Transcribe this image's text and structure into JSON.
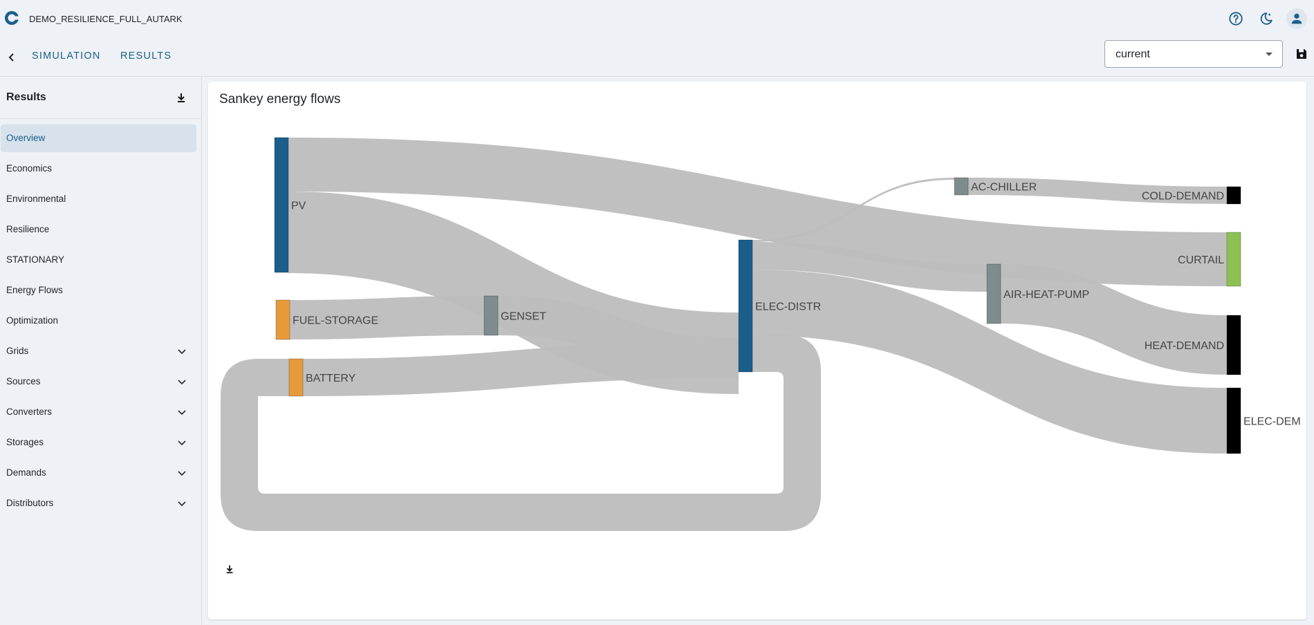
{
  "app": {
    "title": "DEMO_RESILIENCE_FULL_AUTARK"
  },
  "icons": {
    "logo": "app-logo-icon",
    "help": "help-circle-icon",
    "theme": "moon-star-icon",
    "profile": "account-icon",
    "back": "chevron-left-icon",
    "save": "floppy-disk-icon",
    "download": "download-icon",
    "expand": "chevron-down-icon"
  },
  "nav": {
    "tabs": [
      {
        "label": "SIMULATION"
      },
      {
        "label": "RESULTS"
      }
    ]
  },
  "scenario_select": {
    "value": "current"
  },
  "sidebar": {
    "title": "Results",
    "items": [
      {
        "label": "Overview",
        "active": true,
        "expandable": false
      },
      {
        "label": "Economics",
        "expandable": false
      },
      {
        "label": "Environmental",
        "expandable": false
      },
      {
        "label": "Resilience",
        "expandable": false
      },
      {
        "label": "STATIONARY",
        "expandable": false
      },
      {
        "label": "Energy Flows",
        "expandable": false
      },
      {
        "label": "Optimization",
        "expandable": false
      },
      {
        "label": "Grids",
        "expandable": true
      },
      {
        "label": "Sources",
        "expandable": true
      },
      {
        "label": "Converters",
        "expandable": true
      },
      {
        "label": "Storages",
        "expandable": true
      },
      {
        "label": "Demands",
        "expandable": true
      },
      {
        "label": "Distributors",
        "expandable": true
      }
    ]
  },
  "main": {
    "card_title": "Sankey energy flows"
  },
  "colors": {
    "accent": "#1a5f8a",
    "pv": "#1b5e8a",
    "storage": "#e79a3c",
    "converter": "#7f8c8d",
    "curtail": "#8cc152",
    "demand": "#000000",
    "link": "#bdbdbd"
  },
  "chart_data": {
    "type": "sankey",
    "nodes": [
      {
        "id": "PV",
        "label": "PV",
        "color": "#1b5e8a"
      },
      {
        "id": "FUEL-STORAGE",
        "label": "FUEL-STORAGE",
        "color": "#e79a3c"
      },
      {
        "id": "BATTERY",
        "label": "BATTERY",
        "color": "#e79a3c"
      },
      {
        "id": "GENSET",
        "label": "GENSET",
        "color": "#7f8c8d"
      },
      {
        "id": "ELEC-DISTR",
        "label": "ELEC-DISTR",
        "color": "#1b5e8a"
      },
      {
        "id": "AC-CHILLER",
        "label": "AC-CHILLER",
        "color": "#7f8c8d"
      },
      {
        "id": "AIR-HEAT-PUMP",
        "label": "AIR-HEAT-PUMP",
        "color": "#7f8c8d"
      },
      {
        "id": "COLD-DEMAND",
        "label": "COLD-DEMAND",
        "color": "#000000"
      },
      {
        "id": "CURTAIL",
        "label": "CURTAIL",
        "color": "#8cc152"
      },
      {
        "id": "HEAT-DEMAND",
        "label": "HEAT-DEMAND",
        "color": "#000000"
      },
      {
        "id": "ELEC-DEM",
        "label": "ELEC-DEM",
        "color": "#000000"
      }
    ],
    "links": [
      {
        "source": "PV",
        "target": "CURTAIL",
        "value": 78
      },
      {
        "source": "PV",
        "target": "ELEC-DISTR",
        "value": 118
      },
      {
        "source": "FUEL-STORAGE",
        "target": "GENSET",
        "value": 57
      },
      {
        "source": "GENSET",
        "target": "ELEC-DISTR",
        "value": 57
      },
      {
        "source": "BATTERY",
        "target": "ELEC-DISTR",
        "value": 54
      },
      {
        "source": "ELEC-DISTR",
        "target": "AC-CHILLER",
        "value": 3
      },
      {
        "source": "ELEC-DISTR",
        "target": "AIR-HEAT-PUMP",
        "value": 40
      },
      {
        "source": "ELEC-DISTR",
        "target": "ELEC-DEM",
        "value": 95
      },
      {
        "source": "ELEC-DISTR",
        "target": "BATTERY",
        "value": 54
      },
      {
        "source": "AC-CHILLER",
        "target": "COLD-DEMAND",
        "value": 25
      },
      {
        "source": "AIR-HEAT-PUMP",
        "target": "HEAT-DEMAND",
        "value": 86
      }
    ]
  }
}
